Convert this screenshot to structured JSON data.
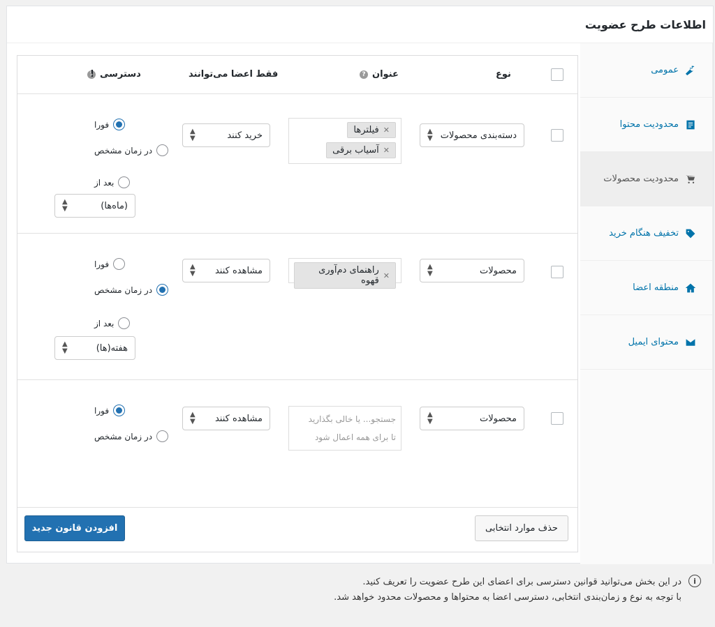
{
  "panel": {
    "title": "اطلاعات طرح عضویت"
  },
  "sidebar": {
    "items": [
      {
        "label": "عمومی",
        "icon": "wrench-icon",
        "active": false
      },
      {
        "label": "محدودیت محتوا",
        "icon": "document-icon",
        "active": false
      },
      {
        "label": "محدودیت محصولات",
        "icon": "cart-icon",
        "active": true
      },
      {
        "label": "تخفیف هنگام خرید",
        "icon": "tag-icon",
        "active": false
      },
      {
        "label": "منطقه اعضا",
        "icon": "home-icon",
        "active": false
      },
      {
        "label": "محتوای ایمیل",
        "icon": "email-icon",
        "active": false
      }
    ]
  },
  "table": {
    "headers": {
      "type": "نوع",
      "title": "عنوان",
      "members_only": "فقط اعضا می‌توانند",
      "access": "دسترسی"
    },
    "rows": [
      {
        "type": "دسته‌بندی محصولات",
        "tags": [
          "فیلترها",
          "آسیاب برقی"
        ],
        "action": "خرید کنند",
        "radios": [
          {
            "label": "فورا",
            "checked": true
          },
          {
            "label": "در زمان مشخص",
            "checked": false
          },
          {
            "label": "بعد از",
            "checked": false
          }
        ],
        "period": "(ماه‌ها)"
      },
      {
        "type": "محصولات",
        "tags": [
          "راهنمای دم‌آوری قهوه"
        ],
        "action": "مشاهده کنند",
        "radios": [
          {
            "label": "فورا",
            "checked": false
          },
          {
            "label": "در زمان مشخص",
            "checked": true
          },
          {
            "label": "بعد از",
            "checked": false
          }
        ],
        "period": "هفته(ها)"
      },
      {
        "type": "محصولات",
        "placeholder_line1": "جستجو... یا خالی بگذارید",
        "placeholder_line2": "تا برای همه اعمال شود",
        "action": "مشاهده کنند",
        "radios": [
          {
            "label": "فورا",
            "checked": true
          },
          {
            "label": "در زمان مشخص",
            "checked": false
          }
        ]
      }
    ]
  },
  "buttons": {
    "delete_selected": "حذف موارد انتخابی",
    "add_rule": "افزودن قانون جدید"
  },
  "notice": {
    "line1": "در این بخش می‌توانید قوانین دسترسی برای اعضای این طرح عضویت را تعریف کنید.",
    "line2": "با توجه به نوع و زمان‌بندی انتخابی، دسترسی اعضا به محتواها و محصولات محدود خواهد شد."
  },
  "colors": {
    "accent": "#2271b1",
    "link": "#0073aa"
  }
}
